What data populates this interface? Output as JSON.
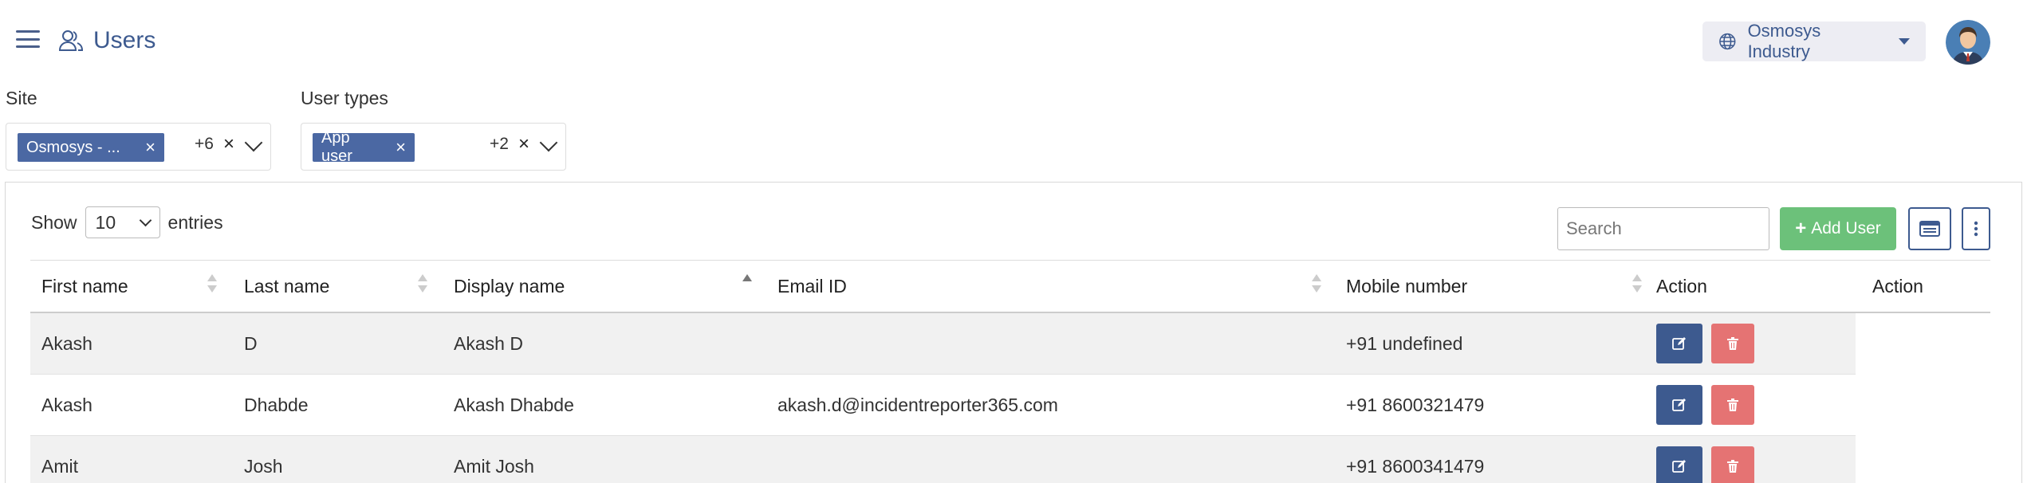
{
  "header": {
    "title": "Users",
    "organization": "Osmosys Industry",
    "icons": {
      "menu": "hamburger-icon",
      "title": "users-icon",
      "org": "globe-icon",
      "avatar": "user-avatar"
    }
  },
  "filters": {
    "site": {
      "label": "Site",
      "selected_chip": "Osmosys - ...",
      "more_count": "+6",
      "clear": "×"
    },
    "user_types": {
      "label": "User types",
      "selected_chip": "App user",
      "more_count": "+2",
      "clear": "×"
    }
  },
  "table_controls": {
    "show_label": "Show",
    "entries_label": "entries",
    "page_length": "10",
    "search_placeholder": "Search",
    "add_button": "Add User"
  },
  "table": {
    "columns": [
      "First name",
      "Last name",
      "Display name",
      "Email ID",
      "Mobile number",
      "Action",
      "Action"
    ],
    "sorted_column": "Display name",
    "sort_direction": "ascending",
    "rows": [
      {
        "first": "Akash",
        "last": "D",
        "display": "Akash D",
        "email": "",
        "mobile": "+91 undefined"
      },
      {
        "first": "Akash",
        "last": "Dhabde",
        "display": "Akash Dhabde",
        "email": "akash.d@incidentreporter365.com",
        "mobile": "+91 8600321479"
      },
      {
        "first": "Amit",
        "last": "Josh",
        "display": "Amit Josh",
        "email": "",
        "mobile": "+91 8600341479"
      }
    ]
  },
  "colors": {
    "primary": "#3d5a8f",
    "chip": "#4b68a3",
    "success": "#6cc17a",
    "danger": "#e57373",
    "stripe": "#f1f1f1"
  }
}
